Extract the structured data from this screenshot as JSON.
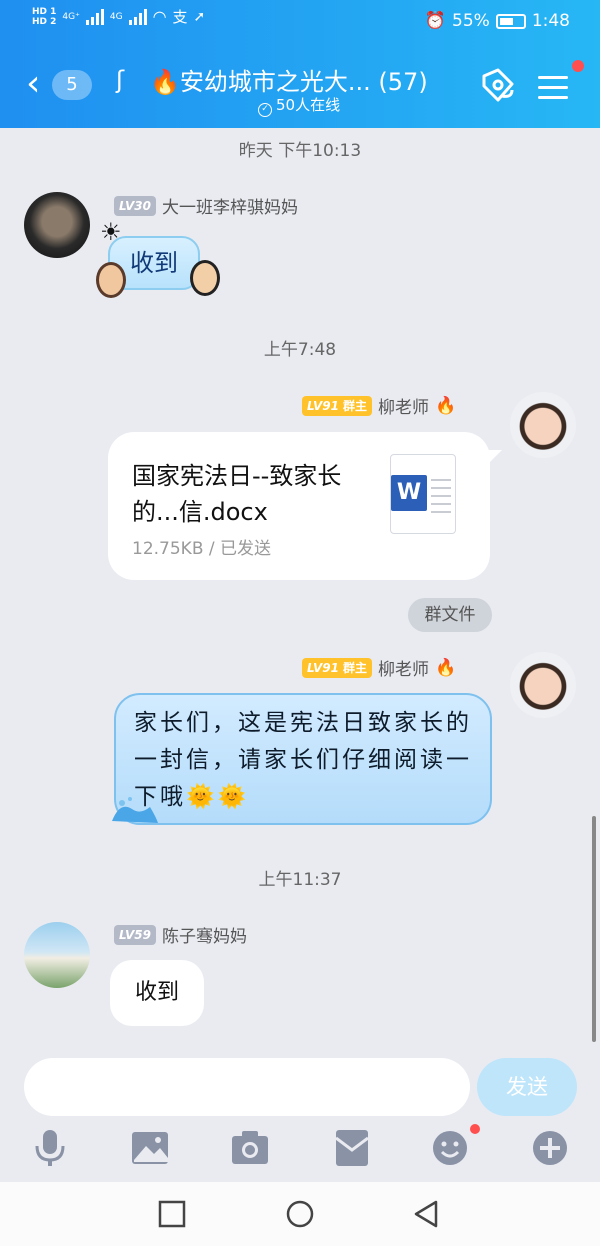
{
  "status_bar": {
    "network_1": "4G⁺",
    "network_2": "4G",
    "battery": "55%",
    "time": "1:48"
  },
  "header": {
    "unread_count": "5",
    "title": "🔥安幼城市之光大...",
    "member_count": "(57)",
    "online": "50人在线"
  },
  "messages": [
    {
      "time": "昨天 下午10:13"
    },
    {
      "level": "LV30",
      "sender": "大一班李梓骐妈妈",
      "sticker_text": "收到"
    },
    {
      "time": "上午7:48"
    },
    {
      "level": "LV91",
      "role": "群主",
      "sender": "柳老师",
      "file": {
        "name": "国家宪法日--致家长的...信.docx",
        "size": "12.75KB",
        "status": "已发送",
        "icon_letter": "W"
      },
      "tag": "群文件"
    },
    {
      "level": "LV91",
      "role": "群主",
      "sender": "柳老师",
      "text": "家长们，这是宪法日致家长的一封信，请家长们仔细阅读一下哦🌞🌞"
    },
    {
      "time": "上午11:37"
    },
    {
      "level": "LV59",
      "sender": "陈子骞妈妈",
      "text": "收到"
    }
  ],
  "input": {
    "placeholder": "",
    "send_label": "发送"
  },
  "toolbar": {
    "items": [
      "microphone-icon",
      "image-icon",
      "camera-icon",
      "red-envelope-icon",
      "emoji-icon",
      "plus-icon"
    ]
  }
}
